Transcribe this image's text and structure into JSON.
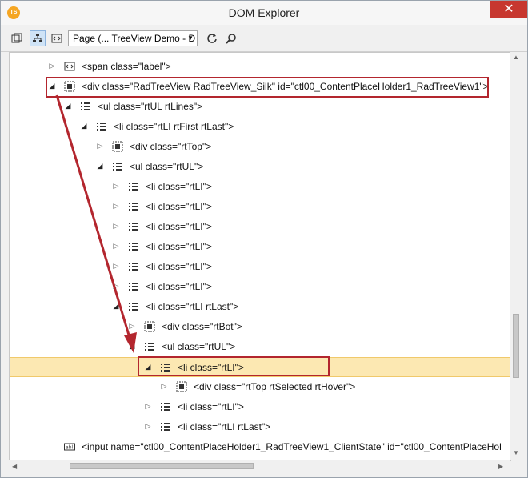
{
  "window": {
    "title": "DOM Explorer",
    "app_icon_text": "TS",
    "close_glyph": "✕"
  },
  "toolbar": {
    "page_selector": "Page (... TreeView Demo - D"
  },
  "tree": {
    "rows": [
      {
        "label": "<span class=\"label\">",
        "depth": 0,
        "expanded": false,
        "icon": "markup-icon"
      },
      {
        "label": "<div class=\"RadTreeView RadTreeView_Silk\" id=\"ctl00_ContentPlaceHolder1_RadTreeView1\">",
        "depth": 0,
        "expanded": true,
        "icon": "element-icon"
      },
      {
        "label": "<ul class=\"rtUL rtLines\">",
        "depth": 1,
        "expanded": true,
        "icon": "list-icon"
      },
      {
        "label": "<li class=\"rtLI rtFirst rtLast\">",
        "depth": 2,
        "expanded": true,
        "icon": "list-icon"
      },
      {
        "label": "<div class=\"rtTop\">",
        "depth": 3,
        "expanded": false,
        "icon": "element-icon"
      },
      {
        "label": "<ul class=\"rtUL\">",
        "depth": 3,
        "expanded": true,
        "icon": "list-icon"
      },
      {
        "label": "<li class=\"rtLI\">",
        "depth": 4,
        "expanded": false,
        "icon": "list-icon"
      },
      {
        "label": "<li class=\"rtLI\">",
        "depth": 4,
        "expanded": false,
        "icon": "list-icon"
      },
      {
        "label": "<li class=\"rtLI\">",
        "depth": 4,
        "expanded": false,
        "icon": "list-icon"
      },
      {
        "label": "<li class=\"rtLI\">",
        "depth": 4,
        "expanded": false,
        "icon": "list-icon"
      },
      {
        "label": "<li class=\"rtLI\">",
        "depth": 4,
        "expanded": false,
        "icon": "list-icon"
      },
      {
        "label": "<li class=\"rtLI\">",
        "depth": 4,
        "expanded": false,
        "icon": "list-icon"
      },
      {
        "label": "<li class=\"rtLI rtLast\">",
        "depth": 4,
        "expanded": true,
        "icon": "list-icon"
      },
      {
        "label": "<div class=\"rtBot\">",
        "depth": 5,
        "expanded": false,
        "icon": "element-icon"
      },
      {
        "label": "<ul class=\"rtUL\">",
        "depth": 5,
        "expanded": true,
        "icon": "list-icon"
      },
      {
        "label": "<li class=\"rtLI\">",
        "depth": 6,
        "expanded": true,
        "icon": "list-icon",
        "selected": true
      },
      {
        "label": "<div class=\"rtTop rtSelected rtHover\">",
        "depth": 7,
        "expanded": false,
        "icon": "element-icon"
      },
      {
        "label": "<li class=\"rtLI\">",
        "depth": 6,
        "expanded": false,
        "icon": "list-icon"
      },
      {
        "label": "<li class=\"rtLI rtLast\">",
        "depth": 6,
        "expanded": false,
        "icon": "list-icon"
      },
      {
        "label": "<input name=\"ctl00_ContentPlaceHolder1_RadTreeView1_ClientState\" id=\"ctl00_ContentPlaceHol",
        "depth": 0,
        "expanded": null,
        "icon": "input-icon"
      }
    ]
  },
  "colors": {
    "highlight_box": "#b3262e",
    "selected_row": "#fce8b2",
    "close_button": "#c7372f"
  }
}
